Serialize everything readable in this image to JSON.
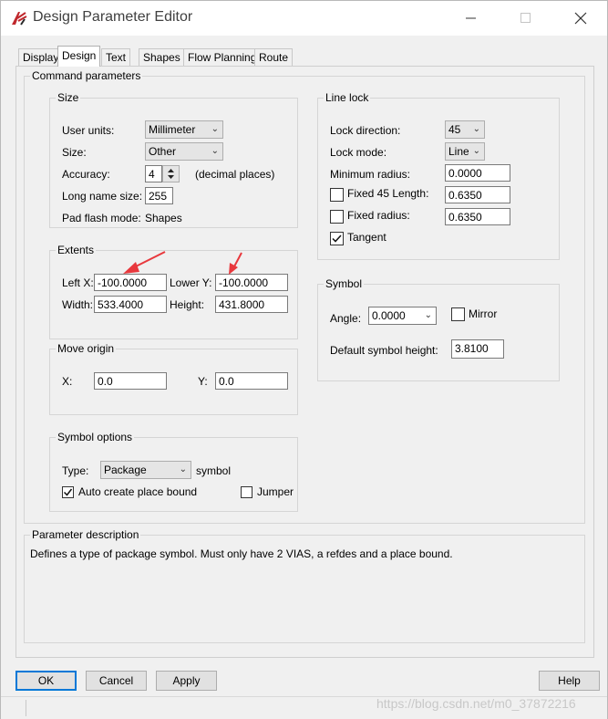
{
  "window": {
    "title": "Design Parameter Editor",
    "app_icon": "allegro-app-icon"
  },
  "tabs": [
    {
      "label": "Display"
    },
    {
      "label": "Design"
    },
    {
      "label": "Text"
    },
    {
      "label": "Shapes"
    },
    {
      "label": "Flow Planning"
    },
    {
      "label": "Route"
    }
  ],
  "command_parameters": {
    "label": "Command parameters"
  },
  "size": {
    "label": "Size",
    "user_units_label": "User units:",
    "user_units_value": "Millimeter",
    "size_label": "Size:",
    "size_value": "Other",
    "accuracy_label": "Accuracy:",
    "accuracy_value": "4",
    "accuracy_suffix": "(decimal places)",
    "long_name_label": "Long name size:",
    "long_name_value": "255",
    "pad_flash_label": "Pad flash mode:",
    "pad_flash_value": "Shapes"
  },
  "extents": {
    "label": "Extents",
    "left_x_label": "Left X:",
    "left_x_value": "-100.0000",
    "lower_y_label": "Lower Y:",
    "lower_y_value": "-100.0000",
    "width_label": "Width:",
    "width_value": "533.4000",
    "height_label": "Height:",
    "height_value": "431.8000"
  },
  "move_origin": {
    "label": "Move origin",
    "x_label": "X:",
    "x_value": "0.0",
    "y_label": "Y:",
    "y_value": "0.0"
  },
  "symbol_options": {
    "label": "Symbol options",
    "type_label": "Type:",
    "type_value": "Package",
    "type_suffix": "symbol",
    "auto_create_label": "Auto create place bound",
    "auto_create_checked": true,
    "jumper_label": "Jumper",
    "jumper_checked": false
  },
  "line_lock": {
    "label": "Line lock",
    "lock_direction_label": "Lock direction:",
    "lock_direction_value": "45",
    "lock_mode_label": "Lock mode:",
    "lock_mode_value": "Line",
    "min_radius_label": "Minimum radius:",
    "min_radius_value": "0.0000",
    "fixed45_label": "Fixed 45 Length:",
    "fixed45_value": "0.6350",
    "fixed45_checked": false,
    "fixed_radius_label": "Fixed radius:",
    "fixed_radius_value": "0.6350",
    "fixed_radius_checked": false,
    "tangent_label": "Tangent",
    "tangent_checked": true
  },
  "symbol": {
    "label": "Symbol",
    "angle_label": "Angle:",
    "angle_value": "0.0000",
    "mirror_label": "Mirror",
    "mirror_checked": false,
    "default_height_label": "Default symbol height:",
    "default_height_value": "3.8100"
  },
  "parameter_description": {
    "label": "Parameter description",
    "text": "Defines a type of package symbol.  Must only have 2 VIAS, a refdes and a place bound."
  },
  "buttons": {
    "ok": "OK",
    "cancel": "Cancel",
    "apply": "Apply",
    "help": "Help"
  },
  "watermark": "https://blog.csdn.net/m0_37872216",
  "colors": {
    "annotation_arrow": "#e8383d",
    "default_button_border": "#0078d7"
  }
}
